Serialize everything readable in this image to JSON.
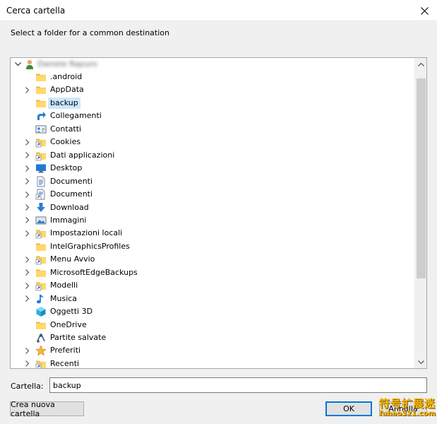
{
  "window": {
    "title": "Cerca cartella"
  },
  "instruction": "Select a folder for a common destination",
  "tree": {
    "root_label": "Daniele Rapuro",
    "items": [
      {
        "label": ".android",
        "icon": "folder-icon",
        "expandable": false
      },
      {
        "label": "AppData",
        "icon": "folder-icon",
        "expandable": true
      },
      {
        "label": "backup",
        "icon": "folder-icon",
        "expandable": false,
        "selected": true
      },
      {
        "label": "Collegamenti",
        "icon": "shortcut-arrow-icon",
        "expandable": false
      },
      {
        "label": "Contatti",
        "icon": "contacts-card-icon",
        "expandable": false
      },
      {
        "label": "Cookies",
        "icon": "shortcut-folder-icon",
        "expandable": true
      },
      {
        "label": "Dati applicazioni",
        "icon": "shortcut-folder-icon",
        "expandable": true
      },
      {
        "label": "Desktop",
        "icon": "desktop-icon",
        "expandable": true
      },
      {
        "label": "Documenti",
        "icon": "documents-icon",
        "expandable": true
      },
      {
        "label": "Documenti",
        "icon": "documents-shortcut-icon",
        "expandable": true
      },
      {
        "label": "Download",
        "icon": "download-arrow-icon",
        "expandable": true
      },
      {
        "label": "Immagini",
        "icon": "pictures-icon",
        "expandable": true
      },
      {
        "label": "Impostazioni locali",
        "icon": "shortcut-folder-icon",
        "expandable": true
      },
      {
        "label": "IntelGraphicsProfiles",
        "icon": "folder-icon",
        "expandable": false
      },
      {
        "label": "Menu Avvio",
        "icon": "shortcut-folder-icon",
        "expandable": true
      },
      {
        "label": "MicrosoftEdgeBackups",
        "icon": "folder-icon",
        "expandable": true
      },
      {
        "label": "Modelli",
        "icon": "shortcut-folder-icon",
        "expandable": true
      },
      {
        "label": "Musica",
        "icon": "music-note-icon",
        "expandable": true
      },
      {
        "label": "Oggetti 3D",
        "icon": "cube-3d-icon",
        "expandable": false
      },
      {
        "label": "OneDrive",
        "icon": "folder-icon",
        "expandable": false
      },
      {
        "label": "Partite salvate",
        "icon": "saved-games-icon",
        "expandable": false
      },
      {
        "label": "Preferiti",
        "icon": "star-icon",
        "expandable": true
      },
      {
        "label": "Recenti",
        "icon": "shortcut-folder-icon",
        "expandable": true
      }
    ]
  },
  "folder_field": {
    "label": "Cartella:",
    "value": "backup"
  },
  "buttons": {
    "new_folder": "Crea nuova cartella",
    "ok": "OK",
    "cancel": "Annulla"
  },
  "watermark": {
    "line1": "符号扩展迷",
    "line2": "fuhao321.com"
  },
  "colors": {
    "selection": "#cce8ff",
    "accent": "#0078d7",
    "folder": "#ffd96a"
  }
}
